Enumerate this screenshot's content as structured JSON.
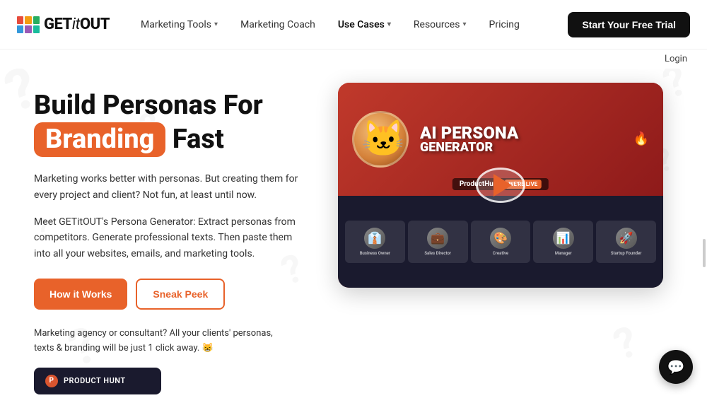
{
  "brand": {
    "name": "GETitOUT",
    "name_styled": "GET it OUT",
    "logo_cells": [
      {
        "color": "#e74c3c"
      },
      {
        "color": "#f39c12"
      },
      {
        "color": "#27ae60"
      },
      {
        "color": "#3498db"
      },
      {
        "color": "#9b59b6"
      },
      {
        "color": "#1abc9c"
      }
    ]
  },
  "nav": {
    "marketing_tools_label": "Marketing Tools",
    "marketing_coach_label": "Marketing Coach",
    "use_cases_label": "Use Cases",
    "resources_label": "Resources",
    "pricing_label": "Pricing",
    "trial_button_label": "Start Your Free Trial",
    "login_label": "Login"
  },
  "hero": {
    "headline_part1": "Build Personas For",
    "headline_highlight": "Branding",
    "headline_part2": "Fast",
    "desc1": "Marketing works better with personas. But creating them for every project and client? Not fun, at least until now.",
    "desc2": "Meet GETitOUT's Persona Generator: Extract personas from competitors. Generate professional texts. Then paste them into all your websites, emails, and marketing tools.",
    "how_works_button": "How it Works",
    "sneak_peek_button": "Sneak Peek",
    "bottom_text": "Marketing agency or consultant? All your clients' personas, texts & branding will be just 1 click away. 😸",
    "producthunt_label": "PRODUCT HUNT"
  },
  "video": {
    "ai_text_line1": "AI PERSONA",
    "ai_text_line2": "GENERATOR",
    "ph_watermark": "ProductHunt",
    "live_badge": "WE'RE LIVE",
    "personas": [
      {
        "label": "Business Owner",
        "emoji": "👔"
      },
      {
        "label": "Sales Director",
        "emoji": "💼"
      },
      {
        "label": "Creative",
        "emoji": "🎨"
      },
      {
        "label": "Manager",
        "emoji": "📊"
      },
      {
        "label": "Startup Founder",
        "emoji": "🚀"
      }
    ]
  },
  "chat": {
    "icon": "💬"
  }
}
